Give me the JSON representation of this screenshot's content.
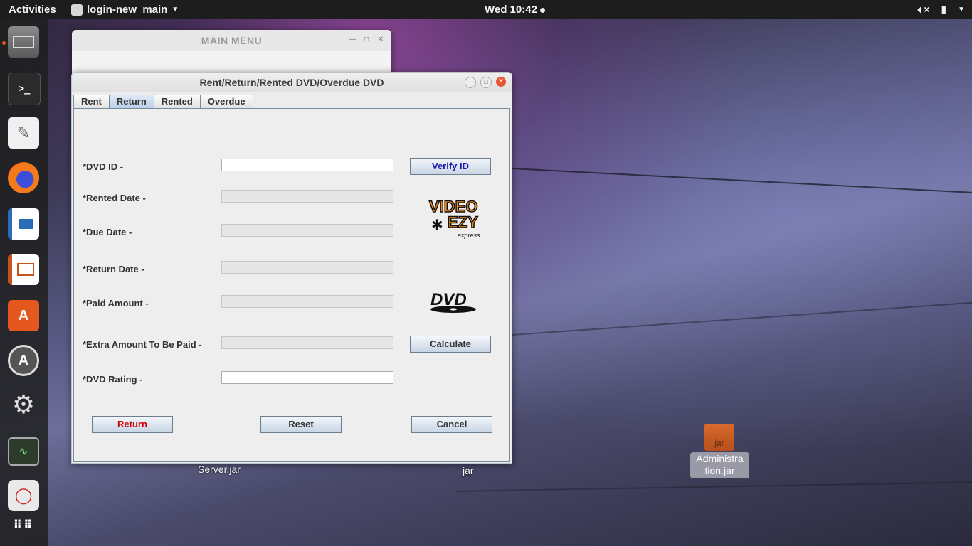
{
  "topbar": {
    "activities": "Activities",
    "app_name": "login-new_main",
    "clock": "Wed 10:42"
  },
  "dock": {
    "items": [
      "files-icon",
      "terminal-icon",
      "text-editor-icon",
      "firefox-icon",
      "writer-icon",
      "impress-icon",
      "software-center-icon",
      "software-updater-icon",
      "settings-icon",
      "system-monitor-icon",
      "remote-desktop-icon",
      "show-apps-icon"
    ]
  },
  "main_menu_window": {
    "title": "MAIN MENU"
  },
  "rent_window": {
    "title": "Rent/Return/Rented DVD/Overdue DVD",
    "tabs": [
      "Rent",
      "Return",
      "Rented",
      "Overdue"
    ],
    "selected_tab": "Return",
    "labels": {
      "dvd_id": "*DVD ID -",
      "rented_date": "*Rented Date -",
      "due_date": "*Due Date -",
      "return_date": "*Return Date -",
      "paid_amount": "*Paid Amount -",
      "extra_amount": "*Extra Amount To Be Paid -",
      "dvd_rating": "*DVD Rating -"
    },
    "values": {
      "dvd_id": "",
      "rented_date": "",
      "due_date": "",
      "return_date": "",
      "paid_amount": "",
      "extra_amount": "",
      "dvd_rating": ""
    },
    "buttons": {
      "verify": "Verify ID",
      "calculate": "Calculate",
      "return": "Return",
      "reset": "Reset",
      "cancel": "Cancel"
    },
    "logo_videoezy": {
      "line1": "VIDEO",
      "line2": "EZY",
      "line3": "express"
    },
    "logo_dvd": "DVD",
    "colors": {
      "verify_text": "#1a1aa8",
      "return_text": "#d00000"
    }
  },
  "desktop": {
    "icons": [
      {
        "label": "Server.jar"
      },
      {
        "label": "jar"
      },
      {
        "label": "Administra tion.jar",
        "badge": "jar"
      }
    ]
  }
}
